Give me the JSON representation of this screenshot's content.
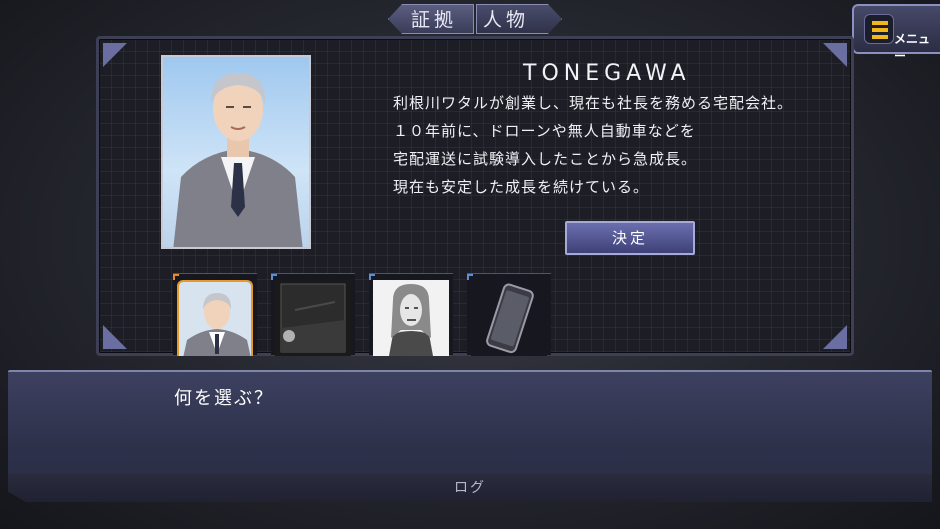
{
  "tabs": {
    "evidence": "証拠",
    "people": "人物",
    "active": "people"
  },
  "menu": {
    "label": "メニュー",
    "icon": "list-menu-icon",
    "accent": "#f4b51c"
  },
  "item": {
    "name": "TONEGAWA",
    "description": [
      "利根川ワタルが創業し、現在も社長を務める宅配会社。",
      "１０年前に、ドローンや無人自動車などを",
      "宅配運送に試験導入したことから急成長。",
      "現在も安定した成長を続けている。"
    ],
    "confirm_label": "決定"
  },
  "thumbnails": [
    {
      "name": "thumb-man-suit",
      "selected": true
    },
    {
      "name": "thumb-dark-street",
      "selected": false
    },
    {
      "name": "thumb-long-hair-man",
      "selected": false
    },
    {
      "name": "thumb-smartphone",
      "selected": false
    }
  ],
  "dialog": {
    "text": "何を選ぶ？",
    "log_label": "ログ"
  },
  "colors": {
    "panel": "#1c1d25",
    "accent_select": "#e79a2b",
    "button": "#5558a0"
  }
}
